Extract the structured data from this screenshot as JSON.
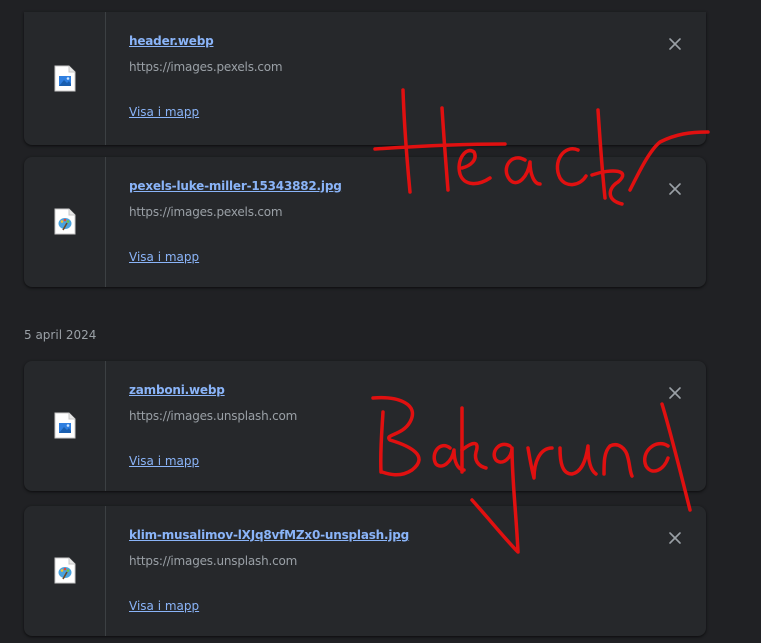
{
  "downloads": [
    {
      "filename": "header.webp",
      "source": "https://images.pexels.com",
      "show_in_folder": "Visa i mapp",
      "icon": "image-file-icon"
    },
    {
      "filename": "pexels-luke-miller-15343882.jpg",
      "source": "https://images.pexels.com",
      "show_in_folder": "Visa i mapp",
      "icon": "paint-file-icon"
    },
    {
      "filename": "zamboni.webp",
      "source": "https://images.unsplash.com",
      "show_in_folder": "Visa i mapp",
      "icon": "image-file-icon"
    },
    {
      "filename": "klim-musalimov-lXJq8vfMZx0-unsplash.jpg",
      "source": "https://images.unsplash.com",
      "show_in_folder": "Visa i mapp",
      "icon": "paint-file-icon"
    }
  ],
  "date_group": "5 april 2024",
  "annotations": [
    "Header",
    "Bakgrund"
  ],
  "colors": {
    "background": "#202124",
    "card": "#26282b",
    "link": "#8ab4f8",
    "text_secondary": "#9aa0a6",
    "annotation": "#e01010"
  }
}
